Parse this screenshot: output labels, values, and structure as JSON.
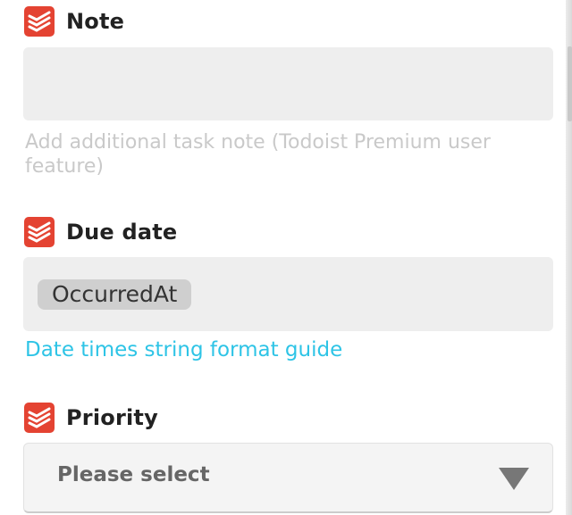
{
  "note": {
    "label": "Note",
    "value": "",
    "helper": "Add additional task note (Todoist Premium user feature)"
  },
  "due_date": {
    "label": "Due date",
    "ingredient": "OccurredAt",
    "link": "Date times string format guide"
  },
  "priority": {
    "label": "Priority",
    "selected": "Please select"
  },
  "icons": {
    "service_logo": "todoist-logo-icon",
    "dropdown": "chevron-down-icon"
  },
  "colors": {
    "brand": "#e44332",
    "link": "#2ec4e6",
    "field_bg": "#eeeeee",
    "helper_text": "#c9c9c9"
  }
}
